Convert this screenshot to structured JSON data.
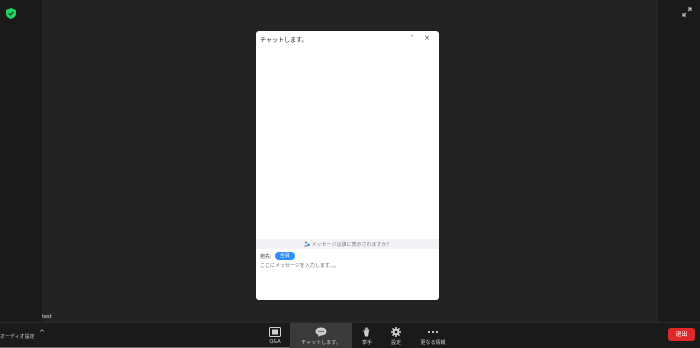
{
  "window": {
    "participant_name": "test"
  },
  "chat": {
    "title": "チャットします。",
    "minimize_glyph": "˅",
    "close_glyph": "×",
    "who_can_see": "メッセージは誰に表示されますか？",
    "to_label": "宛先:",
    "to_value": "全員",
    "input_placeholder": "ここにメッセージを入力します。。。"
  },
  "toolbar": {
    "audio_label": "オーディオ設定",
    "audio_caret": "^",
    "items": [
      {
        "id": "qa",
        "label": "Q&A",
        "icon": "qa-icon"
      },
      {
        "id": "chat",
        "label": "チャットします。",
        "icon": "chat-bubble-icon",
        "active": true
      },
      {
        "id": "raise-hand",
        "label": "挙手",
        "icon": "hand-icon"
      },
      {
        "id": "settings",
        "label": "設定",
        "icon": "gear-icon"
      },
      {
        "id": "more",
        "label": "更なる情報",
        "icon": "more-dots-icon"
      }
    ],
    "leave_label": "退出"
  },
  "colors": {
    "background": "#1a1a1a",
    "stage": "#232323",
    "accent_blue": "#2d8cff",
    "leave_red": "#e02828",
    "shield_green": "#23d160"
  }
}
